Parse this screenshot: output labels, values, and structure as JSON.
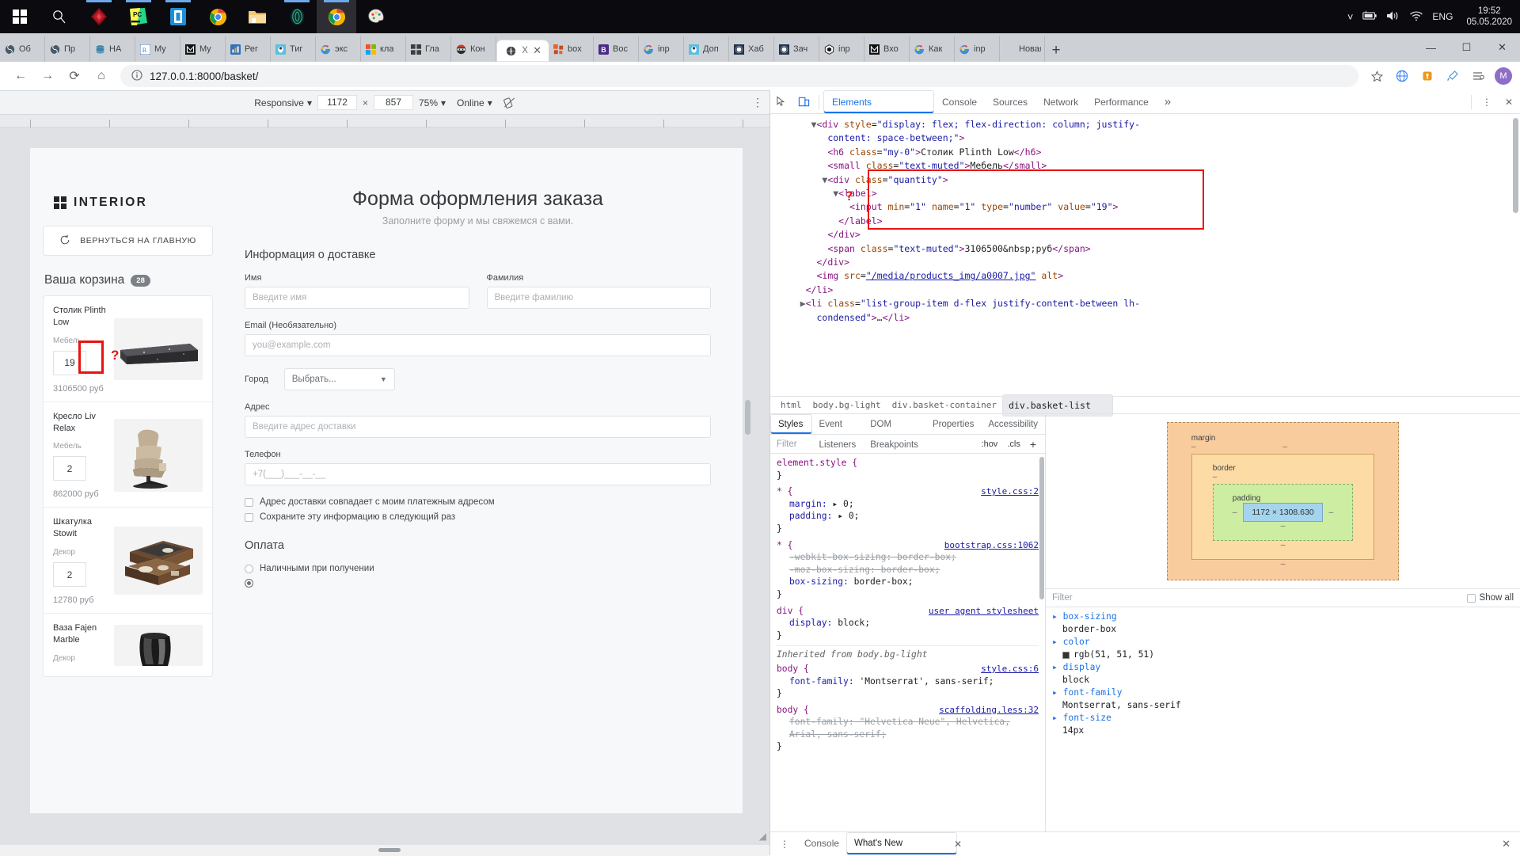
{
  "taskbar": {
    "icons": [
      "windows-start",
      "search",
      "alienware",
      "pycharm",
      "phone-link",
      "chrome",
      "file-explorer",
      "gitkraken",
      "chrome-active",
      "paint"
    ],
    "tray": {
      "chevron": "⌃",
      "battery": "battery-icon",
      "volume": "volume-icon",
      "wifi": "wifi-icon",
      "lang": "ENG"
    },
    "clock": {
      "time": "19:52",
      "date": "05.05.2020"
    }
  },
  "browser": {
    "tabs": [
      {
        "label": "Об",
        "fav": "☯"
      },
      {
        "label": "Пр",
        "fav": "☯"
      },
      {
        "label": "НА",
        "fav": "db"
      },
      {
        "label": "My",
        "fav": "R"
      },
      {
        "label": "My",
        "fav": "M"
      },
      {
        "label": "Рег",
        "fav": "chart"
      },
      {
        "label": "Тиг",
        "fav": "bug"
      },
      {
        "label": "экс",
        "fav": "G"
      },
      {
        "label": "кла",
        "fav": "ms"
      },
      {
        "label": "Гла",
        "fav": "grid"
      },
      {
        "label": "Кон",
        "fav": "ninja"
      },
      {
        "label": "X",
        "fav": "globe",
        "selected": true
      },
      {
        "label": "box",
        "fav": "boxes"
      },
      {
        "label": "Вос",
        "fav": "B"
      },
      {
        "label": "inp",
        "fav": "G"
      },
      {
        "label": "Доп",
        "fav": "bug"
      },
      {
        "label": "Хаб",
        "fav": "moon"
      },
      {
        "label": "Зач",
        "fav": "moon"
      },
      {
        "label": "inp",
        "fav": "hex"
      },
      {
        "label": "Вхо",
        "fav": "M"
      },
      {
        "label": "Как",
        "fav": "G"
      },
      {
        "label": "inp",
        "fav": "G"
      },
      {
        "label": "Новая",
        "fav": ""
      }
    ],
    "newtab_label": "+",
    "window_controls": {
      "minimize": "—",
      "maximize": "☐",
      "close": "✕"
    },
    "url": "127.0.0.1:8000/basket/",
    "nav": {
      "back": "←",
      "forward": "→",
      "reload": "⟳",
      "home": "⌂"
    },
    "omnibox_icons": [
      "info-icon",
      "star-icon",
      "translate-icon",
      "extension-icon",
      "eyedropper-icon",
      "reading-list-icon"
    ],
    "avatar_letter": "M"
  },
  "device_toolbar": {
    "device": "Responsive",
    "width": "1172",
    "height": "857",
    "zoom": "75%",
    "throttling": "Online",
    "rotate_icon": "rotate-icon",
    "kebab": "⋮"
  },
  "page": {
    "logo": "INTERIOR",
    "back_button": "ВЕРНУТЬСЯ НА ГЛАВНУЮ",
    "back_icon": "refresh-ccw-icon",
    "basket_title": "Ваша корзина",
    "basket_count": "28",
    "items": [
      {
        "name": "Столик Plinth Low",
        "category": "Мебель",
        "qty": "19",
        "price": "3106500 руб",
        "thumb": "table-dark"
      },
      {
        "name": "Кресло Liv Relax",
        "category": "Мебель",
        "qty": "2",
        "price": "862000 руб",
        "thumb": "armchair-beige"
      },
      {
        "name": "Шкатулка Stowit",
        "category": "Декор",
        "qty": "2",
        "price": "12780 руб",
        "thumb": "jewelry-box"
      },
      {
        "name": "Ваза Fajen Marble",
        "category": "Декор",
        "qty": "",
        "price": "",
        "thumb": "vase-marble"
      }
    ],
    "form": {
      "title": "Форма оформления заказа",
      "subtitle": "Заполните форму и мы свяжемся с вами.",
      "delivery_heading": "Информация о доставке",
      "first_name_label": "Имя",
      "first_name_placeholder": "Введите имя",
      "last_name_label": "Фамилия",
      "last_name_placeholder": "Введите фамилию",
      "email_label": "Email (Необязательно)",
      "email_placeholder": "you@example.com",
      "city_label": "Город",
      "city_value": "Выбрать...",
      "address_label": "Адрес",
      "address_placeholder": "Введите адрес доставки",
      "phone_label": "Телефон",
      "phone_placeholder": "+7(___)___-__-__",
      "checkbox_same_address": "Адрес доставки совпадает с моим платежным адресом",
      "checkbox_save_info": "Сохраните эту информацию в следующий раз",
      "payment_heading": "Оплата",
      "payment_option_1": "Наличными при получении"
    }
  },
  "devtools": {
    "tabs": [
      "Elements",
      "Console",
      "Sources",
      "Network",
      "Performance"
    ],
    "selected_tab": "Elements",
    "more": "»",
    "kebab": "⋮",
    "close": "✕",
    "inspect_icon": "inspect-icon",
    "device-toggle_icon": "device-toolbar-icon",
    "dom_lines": [
      {
        "indent": 3,
        "tri": "▼",
        "html": "<span class='tg'>&lt;div</span> <span class='at'>style</span>=<span class='av'>\"display: flex; flex-direction: column; justify-</span>"
      },
      {
        "indent": 4,
        "tri": "",
        "html": "<span class='av'>content: space-between;\"</span><span class='tg'>&gt;</span>"
      },
      {
        "indent": 4,
        "tri": "",
        "html": "<span class='tg'>&lt;h6</span> <span class='at'>class</span>=<span class='av'>\"my-0\"</span><span class='tg'>&gt;</span>Столик Plinth Low<span class='tg'>&lt;/h6&gt;</span>"
      },
      {
        "indent": 4,
        "tri": "",
        "html": "<span class='tg'>&lt;small</span> <span class='at'>class</span>=<span class='av'>\"text-muted\"</span><span class='tg'>&gt;</span>Мебель<span class='tg'>&lt;/small&gt;</span>"
      },
      {
        "indent": 4,
        "tri": "▼",
        "html": "<span class='tg'>&lt;div</span> <span class='at'>class</span>=<span class='av'>\"quantity\"</span><span class='tg'>&gt;</span>"
      },
      {
        "indent": 5,
        "tri": "▼",
        "html": "<span class='tg'>&lt;label&gt;</span>"
      },
      {
        "indent": 6,
        "tri": "",
        "html": "<span class='tg'>&lt;input</span> <span class='at'>min</span>=<span class='av'>\"1\"</span> <span class='at'>name</span>=<span class='av'>\"1\"</span> <span class='at'>type</span>=<span class='av'>\"number\"</span> <span class='at'>value</span>=<span class='av'>\"19\"</span><span class='tg'>&gt;</span>"
      },
      {
        "indent": 5,
        "tri": "",
        "html": "<span class='tg'>&lt;/label&gt;</span>"
      },
      {
        "indent": 4,
        "tri": "",
        "html": "<span class='tg'>&lt;/div&gt;</span>"
      },
      {
        "indent": 4,
        "tri": "",
        "html": "<span class='tg'>&lt;span</span> <span class='at'>class</span>=<span class='av'>\"text-muted\"</span><span class='tg'>&gt;</span>3106500&amp;nbsp;руб<span class='tg'>&lt;/span&gt;</span>"
      },
      {
        "indent": 3,
        "tri": "",
        "html": "<span class='tg'>&lt;/div&gt;</span>"
      },
      {
        "indent": 3,
        "tri": "",
        "html": "<span class='tg'>&lt;img</span> <span class='at'>src</span>=<span class='lnk'>\"/media/products_img/a0007.jpg\"</span> <span class='at'>alt</span><span class='tg'>&gt;</span>"
      },
      {
        "indent": 2,
        "tri": "",
        "html": "<span class='tg'>&lt;/li&gt;</span>"
      },
      {
        "indent": 2,
        "tri": "▶",
        "html": "<span class='tg'>&lt;li</span> <span class='at'>class</span>=<span class='av'>\"list-group-item d-flex justify-content-between lh-</span>"
      },
      {
        "indent": 3,
        "tri": "",
        "html": "<span class='av'>condensed\"</span><span class='tg'>&gt;</span>…<span class='tg'>&lt;/li&gt;</span>"
      }
    ],
    "highlight_marker": "?",
    "breadcrumbs": [
      "html",
      "body.bg-light",
      "div.basket-container",
      "div.basket-list"
    ],
    "style_tabs": [
      "Styles",
      "Event Listeners",
      "DOM Breakpoints",
      "Properties",
      "Accessibility"
    ],
    "style_selected": "Styles",
    "filter_placeholder": "Filter",
    "hov": ":hov",
    "cls": ".cls",
    "plus": "+",
    "rules": [
      {
        "selector": "element.style {",
        "source": "",
        "decls": [],
        "close": "}"
      },
      {
        "selector": "* {",
        "source": "style.css:2",
        "decls": [
          {
            "p": "margin",
            "v": "▸ 0;",
            "strike": false
          },
          {
            "p": "padding",
            "v": "▸ 0;",
            "strike": false
          }
        ],
        "close": "}"
      },
      {
        "selector": "* {",
        "source": "bootstrap.css:1062",
        "decls": [
          {
            "p": "-webkit-box-sizing",
            "v": "border-box;",
            "strike": true
          },
          {
            "p": "-moz-box-sizing",
            "v": "border-box;",
            "strike": true
          },
          {
            "p": "box-sizing",
            "v": "border-box;",
            "strike": false
          }
        ],
        "close": "}"
      },
      {
        "selector": "div {",
        "source": "user agent stylesheet",
        "decls": [
          {
            "p": "display",
            "v": "block;",
            "strike": false
          }
        ],
        "close": "}"
      },
      {
        "selector": "body {",
        "source": "style.css:6",
        "decls": [
          {
            "p": "font-family",
            "v": "'Montserrat', sans-serif;",
            "strike": false
          }
        ],
        "close": "}"
      },
      {
        "selector": "body {",
        "source": "scaffolding.less:32",
        "decls": [
          {
            "p": "font-family",
            "v": "\"Helvetica Neue\", Helvetica, Arial, sans-serif;",
            "strike": true
          }
        ],
        "close": "}"
      }
    ],
    "inherited_label": "Inherited from body.bg-light",
    "box_model": {
      "margin_label": "margin",
      "border_label": "border",
      "padding_label": "padding",
      "content": "1172 × 1308.630",
      "dash": "–"
    },
    "computed_filter_placeholder": "Filter",
    "show_all_label": "Show all",
    "computed": [
      {
        "key": "box-sizing",
        "value": "border-box",
        "swatch": ""
      },
      {
        "key": "color",
        "value": "rgb(51, 51, 51)",
        "swatch": "#333333"
      },
      {
        "key": "display",
        "value": "block",
        "swatch": ""
      },
      {
        "key": "font-family",
        "value": "Montserrat, sans-serif",
        "swatch": ""
      },
      {
        "key": "font-size",
        "value": "14px",
        "swatch": ""
      }
    ],
    "drawer_tabs": [
      "Console",
      "What's New"
    ],
    "drawer_selected": "What's New",
    "drawer_kebab": "⋮",
    "drawer_close": "✕"
  }
}
